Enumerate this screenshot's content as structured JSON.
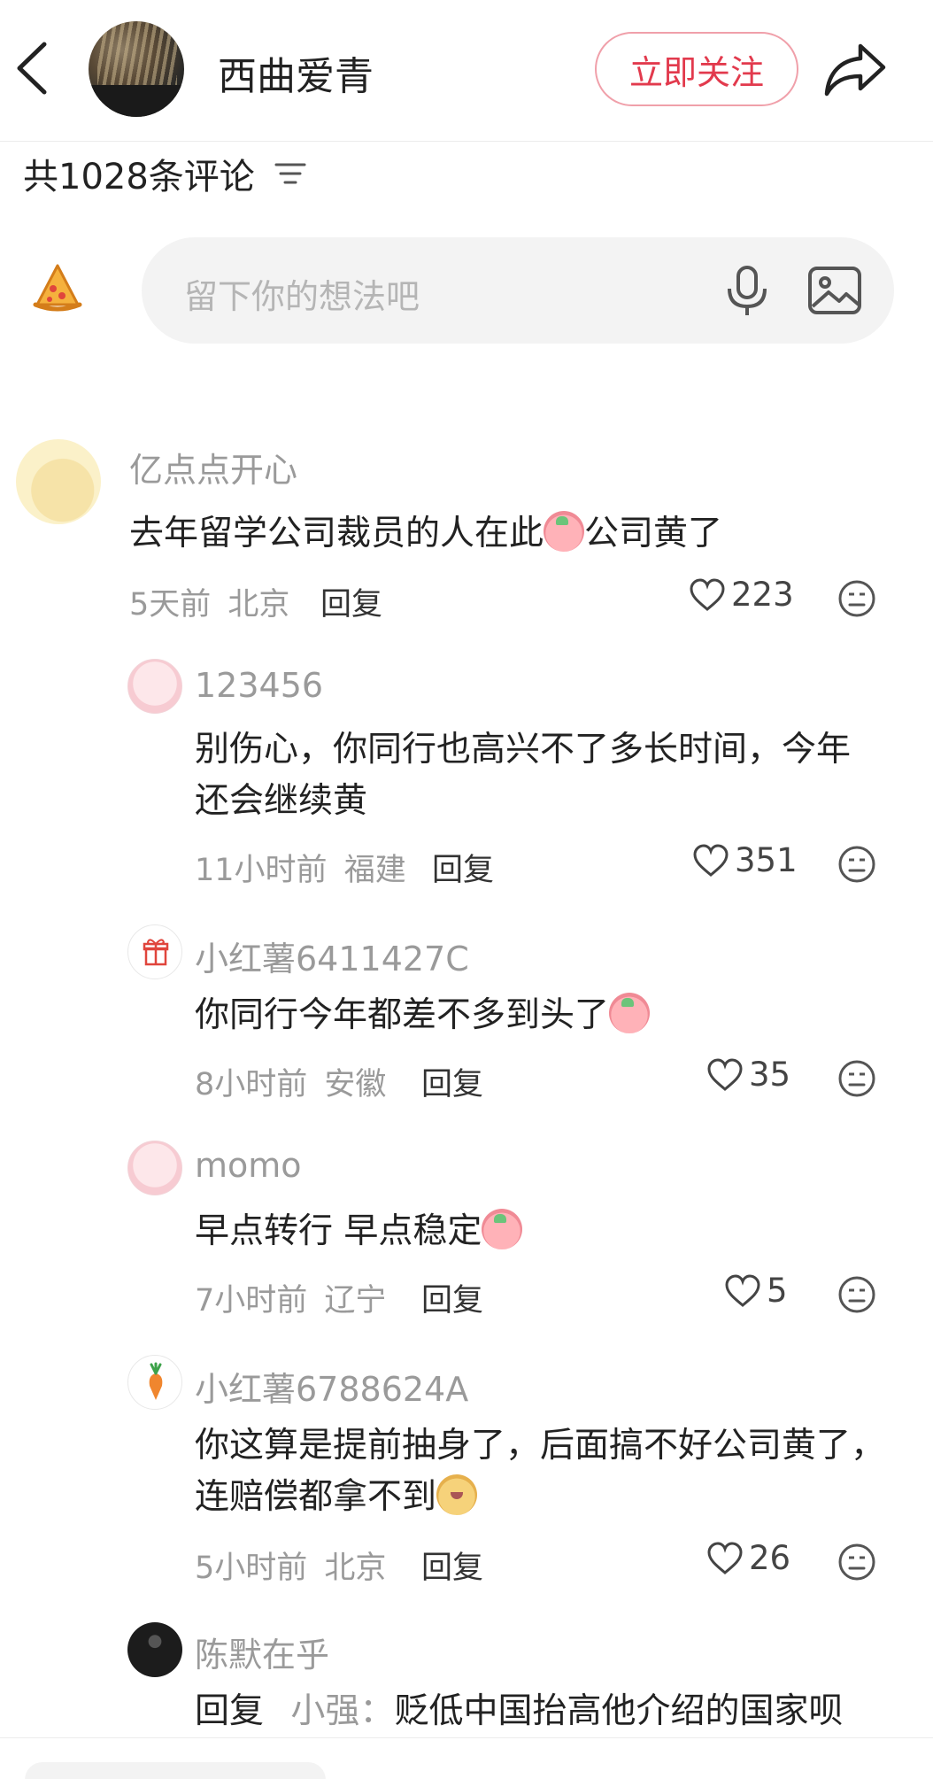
{
  "header": {
    "title": "西曲爱青",
    "follow_label": "立即关注"
  },
  "comments_header": {
    "count_label": "共1028条评论"
  },
  "input": {
    "placeholder": "留下你的想法吧"
  },
  "comments": [
    {
      "name": "亿点点开心",
      "text_before": "去年留学公司裁员的人在此",
      "text_after": "公司黄了",
      "time": "5天前",
      "location": "北京",
      "reply": "回复",
      "likes": "223"
    },
    {
      "name": "123456",
      "text": "别伤心，你同行也高兴不了多长时间，今年还会继续黄",
      "time": "11小时前",
      "location": "福建",
      "reply": "回复",
      "likes": "351"
    },
    {
      "name": "小红薯6411427C",
      "text_before": "你同行今年都差不多到头了",
      "time": "8小时前",
      "location": "安徽",
      "reply": "回复",
      "likes": "35"
    },
    {
      "name": "momo",
      "text_before": "早点转行 早点稳定",
      "time": "7小时前",
      "location": "辽宁",
      "reply": "回复",
      "likes": "5"
    },
    {
      "name": "小红薯6788624A",
      "text_before": "你这算是提前抽身了，后面搞不好公司黄了，连赔偿都拿不到",
      "time": "5小时前",
      "location": "北京",
      "reply": "回复",
      "likes": "26"
    },
    {
      "name": "陈默在乎",
      "reply_prefix": "回复",
      "reply_to": "小强：",
      "text": "贬低中国抬高他介绍的国家呗"
    }
  ],
  "colors": {
    "accent": "#e23a4d",
    "muted": "#9a9a9a"
  }
}
